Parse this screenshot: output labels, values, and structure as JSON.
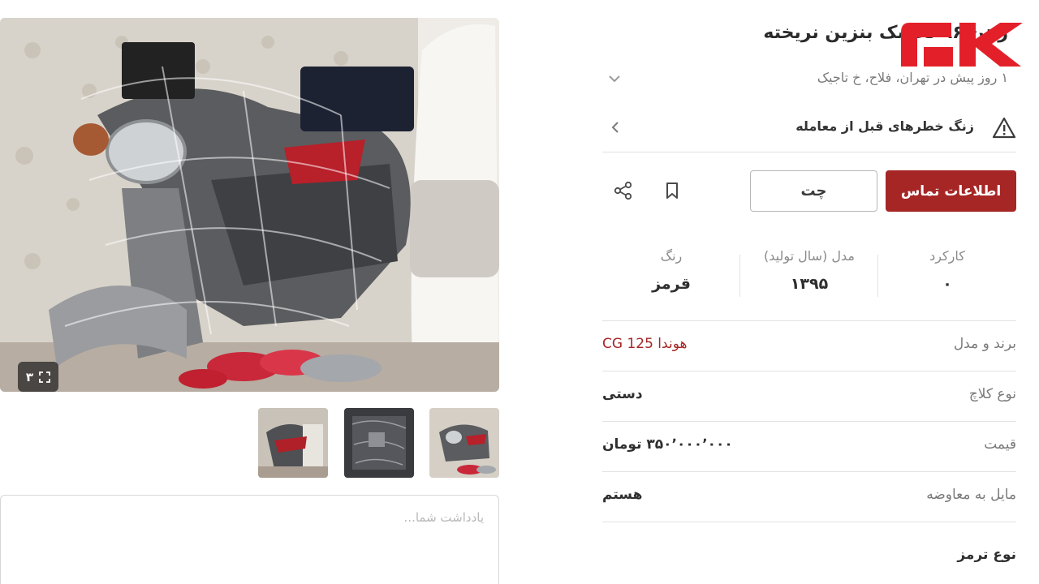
{
  "listing": {
    "title": "رهن ۹۶ تخشک بنزین نریخته",
    "subtitle": "۱ روز پیش در تهران، فلاح، خ تاجیک",
    "photo_count": "۳"
  },
  "notice": {
    "text": "زنگ خطرهای قبل از معامله"
  },
  "actions": {
    "contact_label": "اطلاعات تماس",
    "chat_label": "چت"
  },
  "stats": [
    {
      "label": "کارکرد",
      "value": "۰"
    },
    {
      "label": "مدل (سال تولید)",
      "value": "۱۳۹۵"
    },
    {
      "label": "رنگ",
      "value": "قرمز"
    }
  ],
  "details": [
    {
      "key": "برند و مدل",
      "value": "هوندا CG 125"
    },
    {
      "key": "نوع کلاچ",
      "value": "دستی"
    },
    {
      "key": "قیمت",
      "value": "۳۵۰٬۰۰۰٬۰۰۰ تومان"
    },
    {
      "key": "مایل به معاوضه",
      "value": "هستم"
    },
    {
      "key": "نوع ترمز",
      "value": ""
    }
  ],
  "note": {
    "placeholder": "یادداشت شما..."
  },
  "colors": {
    "brand": "#a62626",
    "logo": "#e3202a"
  },
  "icons": {
    "expand": "expand-icon",
    "chevron_down": "chevron-down-icon",
    "chevron_left": "chevron-left-icon",
    "warning": "warning-icon",
    "bookmark": "bookmark-icon",
    "share": "share-icon",
    "logo": "rokna-logo"
  }
}
